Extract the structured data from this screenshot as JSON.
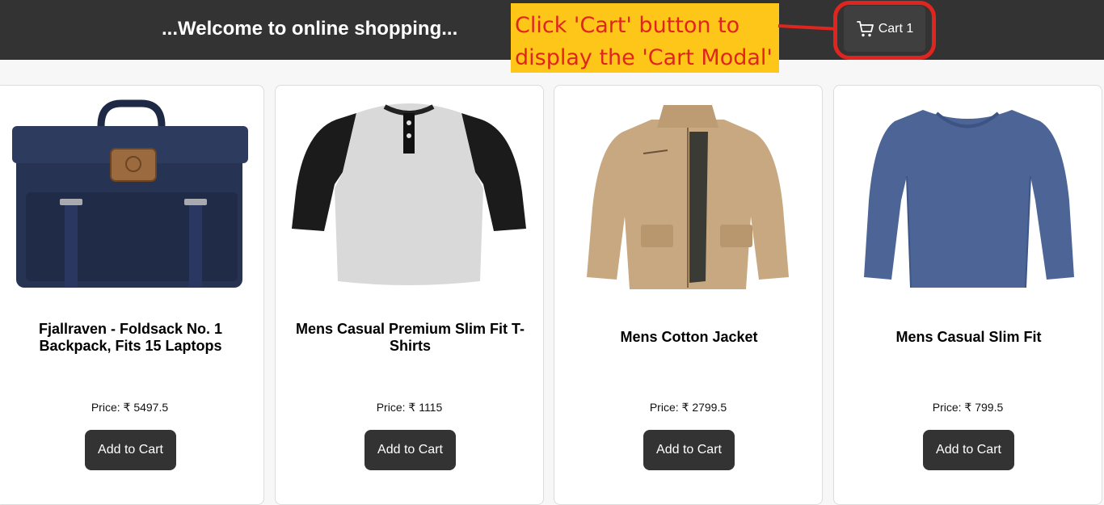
{
  "header": {
    "welcome": "...Welcome to online shopping...",
    "cart_label": "Cart 1",
    "cart_icon": "shopping-cart-icon"
  },
  "annotation": {
    "text": "Click 'Cart' button to\ndisplay the 'Cart Modal'"
  },
  "products": [
    {
      "title": "Fjallraven - Foldsack No. 1 Backpack, Fits 15 Laptops",
      "price": "Price: ₹ 5497.5",
      "button": "Add to Cart",
      "image": "backpack-image"
    },
    {
      "title": "Mens Casual Premium Slim Fit T-Shirts",
      "price": "Price: ₹ 1115",
      "button": "Add to Cart",
      "image": "raglan-tshirt-image"
    },
    {
      "title": "Mens Cotton Jacket",
      "price": "Price: ₹ 2799.5",
      "button": "Add to Cart",
      "image": "cotton-jacket-image"
    },
    {
      "title": "Mens Casual Slim Fit",
      "price": "Price: ₹ 799.5",
      "button": "Add to Cart",
      "image": "slim-fit-shirt-image"
    }
  ],
  "colors": {
    "header_bg": "#333333",
    "annotation_bg": "#ffc61a",
    "annotation_text": "#e0251f",
    "button_bg": "#333333"
  }
}
